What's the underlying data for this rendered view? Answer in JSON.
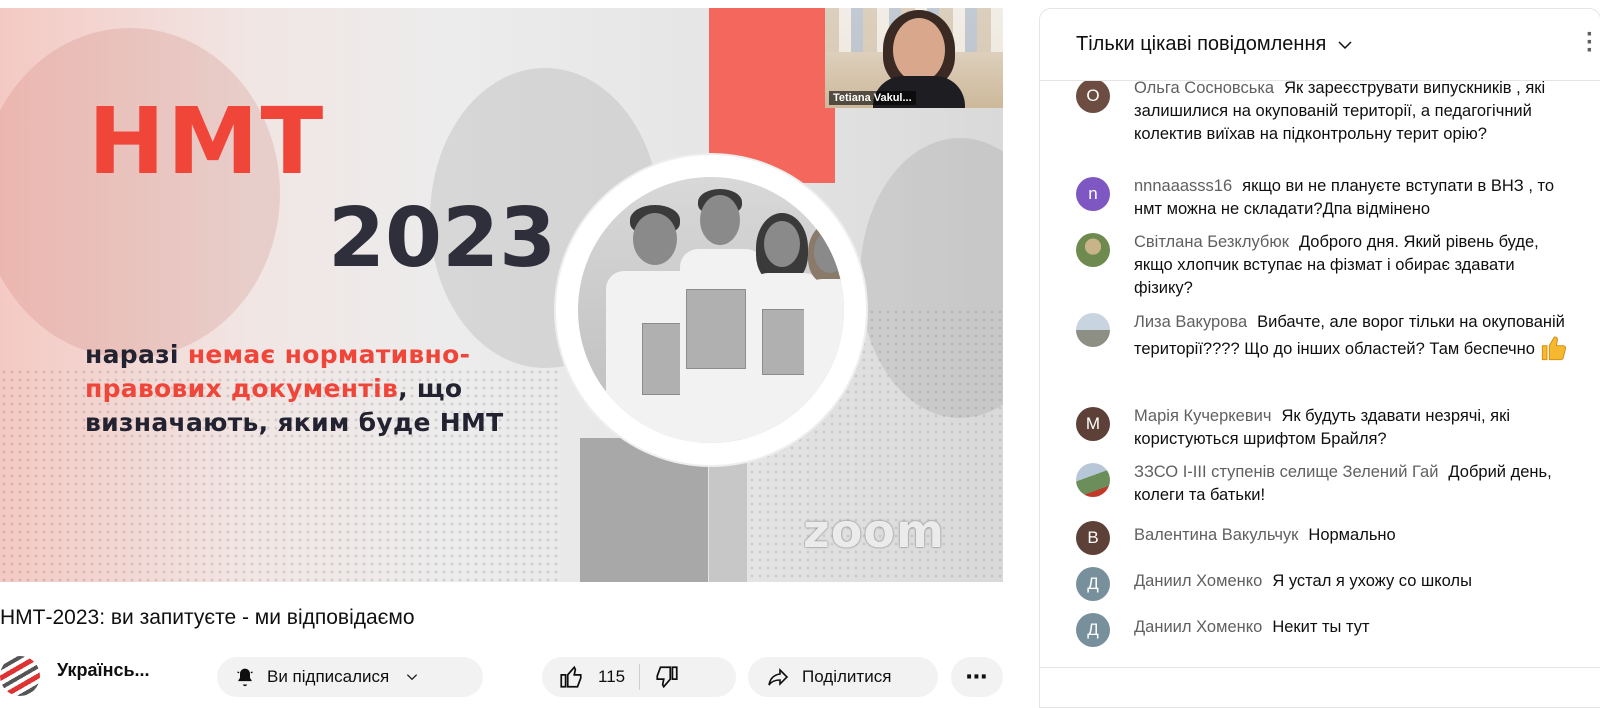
{
  "video": {
    "slide_title": "НМТ",
    "slide_year": "2023",
    "slide_text_1": "наразі ",
    "slide_text_highlight": "немає нормативно-правових документів",
    "slide_text_2": ", що визначають, яким буде НМТ",
    "pip_name": "Tetiana Vakul...",
    "watermark": "zoom"
  },
  "title": "НМТ-2023: ви запитуєте - ми відповідаємо",
  "channel": {
    "name": "Українсь..."
  },
  "actions": {
    "subscribe_label": "Ви підписалися",
    "like_count": "115",
    "share_label": "Поділитися",
    "more_label": "⋯"
  },
  "chat": {
    "mode_label": "Тільки цікаві повідомлення",
    "messages": [
      {
        "initial": "О",
        "avatar_color": "#6d4c41",
        "author": "Ольга Сосновська",
        "text": "Як зареєструвати випускників , які залишилися на окупованій території, а педагогічний колектив виїхав на підконтрольну терит орію?"
      },
      {
        "initial": "n",
        "avatar_color": "#7e57c2",
        "author": "nnnaaasss16",
        "text": "якщо ви не плануєте вступати в ВНЗ , то нмт можна не складати?Дпа відмінено"
      },
      {
        "initial": "",
        "avatar_color": "#8d9a6b",
        "author": "Світлана Безклубюк",
        "text": "Доброго дня. Який рівень буде, якщо хлопчик вступає на фізмат і обирає здавати фізику?"
      },
      {
        "initial": "",
        "avatar_color": "#9aa9b8",
        "author": "Лиза Вакурова",
        "text": "Вибачте, але ворог тільки на окупованій території???? Що до інших областей? Там беспечно"
      },
      {
        "initial": "М",
        "avatar_color": "#5d4037",
        "author": "Марія Кучеркевич",
        "text": "Як будуть здавати незрячі, які користуються шрифтом Брайля?"
      },
      {
        "initial": "",
        "avatar_color": "#6b8e5a",
        "author": "ЗЗСО І-ІІІ ступенів селище Зелений Гай",
        "text": "Добрий день, колеги та батьки!"
      },
      {
        "initial": "В",
        "avatar_color": "#5d4037",
        "author": "Валентина Вакульчук",
        "text": "Нормально"
      },
      {
        "initial": "Д",
        "avatar_color": "#78909c",
        "author": "Даниил Хоменко",
        "text": "Я устал я ухожу со школы"
      },
      {
        "initial": "Д",
        "avatar_color": "#78909c",
        "author": "Даниил Хоменко",
        "text": "Некит ты тут"
      }
    ]
  }
}
